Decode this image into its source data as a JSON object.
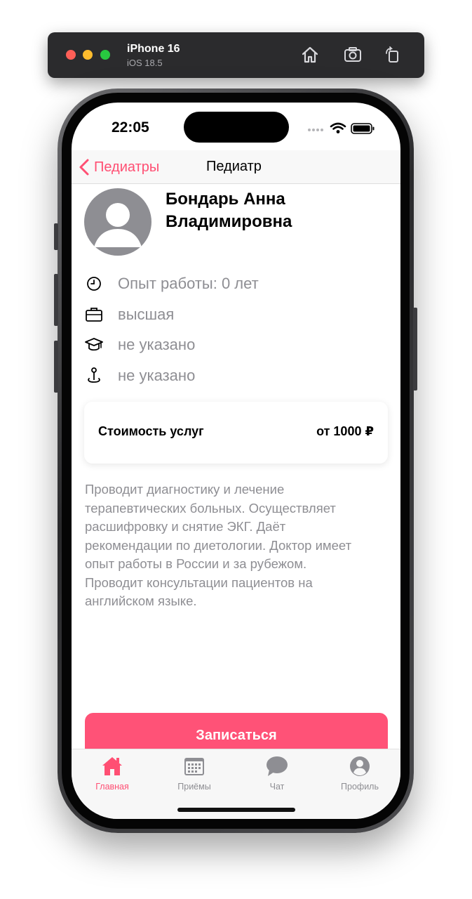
{
  "simulator": {
    "device_name": "iPhone 16",
    "os_version": "iOS 18.5",
    "icons": [
      "home-icon",
      "screenshot-icon",
      "rotate-icon"
    ]
  },
  "status_bar": {
    "time": "22:05",
    "icons": [
      "signal-icon",
      "wifi-icon",
      "battery-icon"
    ]
  },
  "nav": {
    "back_label": "Педиатры",
    "title": "Педиатр"
  },
  "doctor": {
    "name_line1": "Бондарь Анна",
    "name_line2": "Владимировна",
    "info": [
      {
        "icon": "clock-icon",
        "text": "Опыт работы: 0 лет"
      },
      {
        "icon": "briefcase-icon",
        "text": "высшая"
      },
      {
        "icon": "graduation-cap-icon",
        "text": "не указано"
      },
      {
        "icon": "location-pin-icon",
        "text": "не указано"
      }
    ]
  },
  "price": {
    "label": "Стоимость услуг",
    "value": "от 1000 ₽"
  },
  "description": {
    "lines": [
      "Проводит диагностику и лечение",
      "терапевтических больных. Осуществляет",
      "расшифровку и снятие ЭКГ. Даёт",
      "рекомендации по диетологии. Доктор имеет",
      "опыт работы в России и за рубежом.",
      "Проводит консультации пациентов на",
      "английском языке."
    ]
  },
  "cta": {
    "label": "Записаться"
  },
  "tabbar": {
    "tabs": [
      {
        "label": "Главная",
        "icon": "house-icon",
        "active": true
      },
      {
        "label": "Приёмы",
        "icon": "calendar-icon",
        "active": false
      },
      {
        "label": "Чат",
        "icon": "chat-bubble-icon",
        "active": false
      },
      {
        "label": "Профиль",
        "icon": "person-circle-icon",
        "active": false
      }
    ]
  },
  "colors": {
    "accent": "#ff4f73",
    "cta_background": "#ff5277",
    "secondary_text": "#8e8e93"
  }
}
